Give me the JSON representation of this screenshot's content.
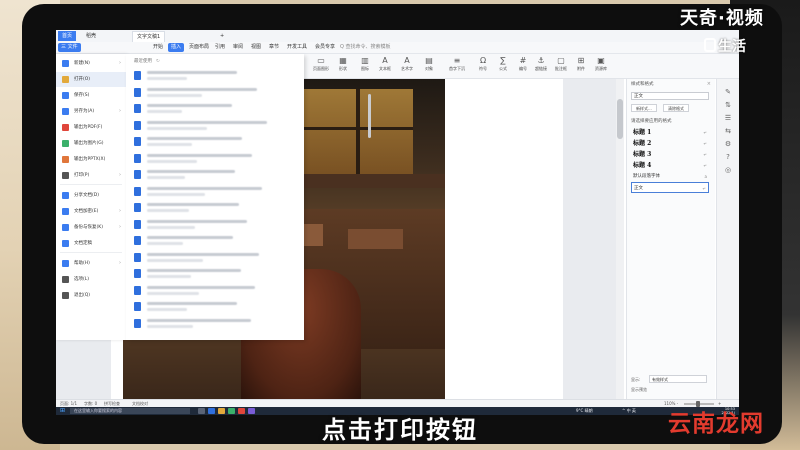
{
  "tabs": [
    {
      "label": "首页"
    },
    {
      "label": "稻壳"
    },
    {
      "label": "文字文稿1"
    },
    {
      "label": "+"
    }
  ],
  "menubar": {
    "file_label": "三 文件",
    "items": [
      "开始",
      "插入",
      "页面布局",
      "引用",
      "审阅",
      "视图",
      "章节",
      "开发工具",
      "会员专享"
    ],
    "search_label": "Q 查找命令、搜索模板"
  },
  "ribbon": [
    {
      "icon": "▭",
      "label": "页面图形"
    },
    {
      "icon": "▦",
      "label": "形状"
    },
    {
      "icon": "▥",
      "label": "图标"
    },
    {
      "icon": "A",
      "label": "文本框"
    },
    {
      "icon": "A",
      "label": "艺术字"
    },
    {
      "icon": "▤",
      "label": "对象"
    },
    {
      "icon": "≡",
      "label": "首字下沉"
    },
    {
      "icon": "Ω",
      "label": "符号"
    },
    {
      "icon": "∑",
      "label": "公式"
    },
    {
      "icon": "#",
      "label": "编号"
    },
    {
      "icon": "⚓",
      "label": "超链接"
    },
    {
      "icon": "▢",
      "label": "批注框"
    },
    {
      "icon": "⊞",
      "label": "附件"
    },
    {
      "icon": "▣",
      "label": "资源库"
    }
  ],
  "file_menu": [
    {
      "label": "新建(N)",
      "arrow": "›",
      "color": "#3b7cf0"
    },
    {
      "label": "打开(O)",
      "arrow": "",
      "color": "#e2a93b"
    },
    {
      "label": "保存(S)",
      "arrow": "",
      "color": "#3b7cf0"
    },
    {
      "label": "另存为(A)",
      "arrow": "›",
      "color": "#3b7cf0"
    },
    {
      "label": "输出为PDF(F)",
      "arrow": "",
      "color": "#e0463b"
    },
    {
      "label": "输出为图片(G)",
      "arrow": "",
      "color": "#3bb06a"
    },
    {
      "label": "输出为PPTX(X)",
      "arrow": "",
      "color": "#e0763b"
    },
    {
      "label": "打印(P)",
      "arrow": "›",
      "color": "#555555"
    },
    {
      "label": "分享文档(D)",
      "arrow": "",
      "color": "#3b7cf0"
    },
    {
      "label": "文档加密(E)",
      "arrow": "›",
      "color": "#3b7cf0"
    },
    {
      "label": "备份与恢复(K)",
      "arrow": "›",
      "color": "#3b7cf0"
    },
    {
      "label": "文档定稿",
      "arrow": "",
      "color": "#3b7cf0"
    },
    {
      "label": "帮助(H)",
      "arrow": "›",
      "color": "#3b7cf0"
    },
    {
      "label": "选项(L)",
      "arrow": "",
      "color": "#555555"
    },
    {
      "label": "退出(Q)",
      "arrow": "",
      "color": "#555555"
    }
  ],
  "recent": {
    "header": "最近使用",
    "refresh_icon": "↻",
    "items": [
      {
        "w1": 90,
        "w2": 40
      },
      {
        "w1": 110,
        "w2": 55
      },
      {
        "w1": 85,
        "w2": 35
      },
      {
        "w1": 120,
        "w2": 60
      },
      {
        "w1": 95,
        "w2": 45
      },
      {
        "w1": 105,
        "w2": 50
      },
      {
        "w1": 88,
        "w2": 38
      },
      {
        "w1": 115,
        "w2": 58
      },
      {
        "w1": 92,
        "w2": 42
      },
      {
        "w1": 100,
        "w2": 48
      },
      {
        "w1": 86,
        "w2": 36
      },
      {
        "w1": 112,
        "w2": 56
      },
      {
        "w1": 94,
        "w2": 44
      },
      {
        "w1": 108,
        "w2": 52
      },
      {
        "w1": 90,
        "w2": 40
      },
      {
        "w1": 104,
        "w2": 46
      }
    ]
  },
  "style_pane": {
    "title": "样式和格式",
    "close": "×",
    "current": "正文",
    "btn_new": "新样式...",
    "btn_clear": "清除格式",
    "subtitle": "请选择要应用的格式",
    "styles": [
      {
        "name": "标题 1",
        "mark": "↵"
      },
      {
        "name": "标题 2",
        "mark": "↵"
      },
      {
        "name": "标题 3",
        "mark": "↵"
      },
      {
        "name": "标题 4",
        "mark": "↵"
      },
      {
        "name": "默认段落字体",
        "mark": "a"
      },
      {
        "name": "正文",
        "mark": "↵"
      }
    ],
    "show_label": "显示:",
    "show_value": "有效样式",
    "preview_label": "显示预览"
  },
  "sidetools": [
    "✎",
    "⇅",
    "☰",
    "⇆",
    "⚙",
    "?",
    "◎"
  ],
  "status": {
    "page": "页面: 1/1",
    "words": "字数: 0",
    "spell": "拼写检查",
    "proofread": "文档校对",
    "zoom": "110% -",
    "zoom_plus": "+"
  },
  "taskbar": {
    "start_icon": "⊞",
    "search": "在这里输入你要搜索的内容",
    "weather": "9°C 晴朗",
    "tray": "^ 中 英",
    "time": "10:53",
    "date": "2022/1/"
  },
  "overlays": {
    "brand": "天奇·视频",
    "brand_sub": "生活",
    "caption": "点击打印按钮",
    "site": "云南龙网"
  }
}
